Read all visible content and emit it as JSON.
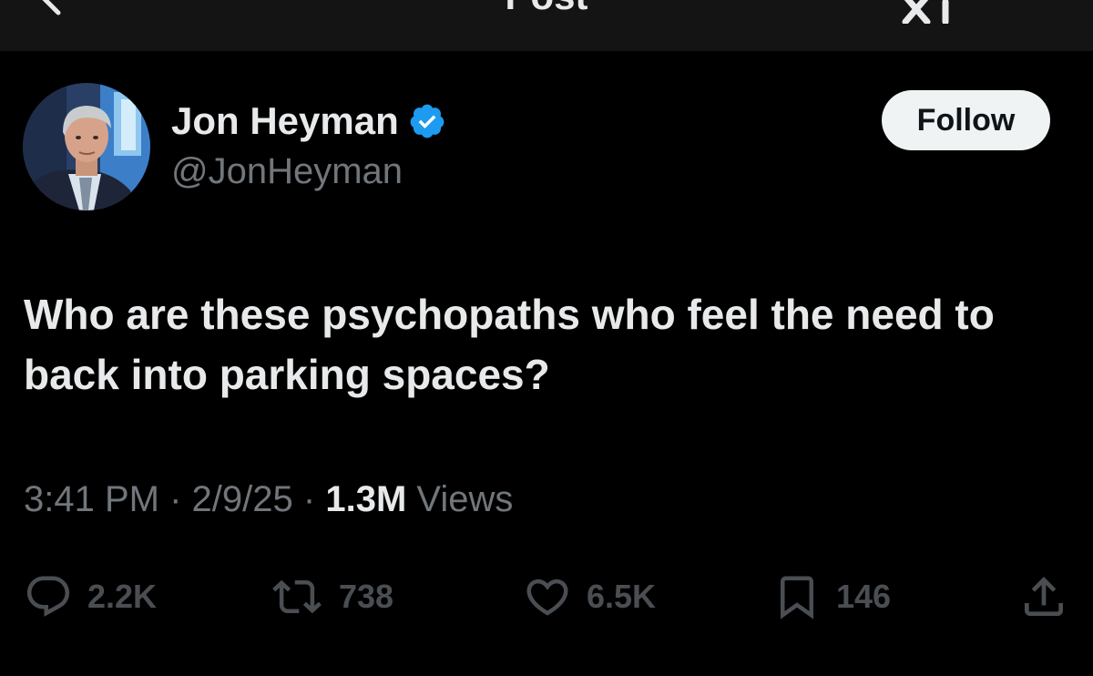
{
  "header": {
    "title": "Post",
    "back_icon": "arrow-left-icon",
    "grok_icon": "grok-icon"
  },
  "author": {
    "display_name": "Jon Heyman",
    "handle": "@JonHeyman",
    "verified_color": "#1d9bf0"
  },
  "follow_label": "Follow",
  "tweet": {
    "text": "Who are these psychopaths who feel the need to back into parking spaces?"
  },
  "meta": {
    "time": "3:41 PM",
    "separator": "·",
    "date": "2/9/25",
    "views_count": "1.3M",
    "views_label": "Views"
  },
  "actions": {
    "replies": "2.2K",
    "reposts": "738",
    "likes": "6.5K",
    "bookmarks": "146"
  },
  "colors": {
    "background": "#000000",
    "text": "#e7e9ea",
    "secondary": "#71767b",
    "accent": "#1d9bf0"
  }
}
